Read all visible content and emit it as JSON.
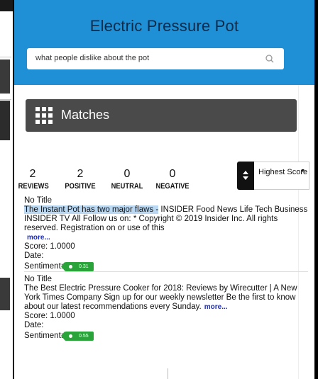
{
  "header": {
    "title": "Electric Pressure Pot",
    "search_value": "what people dislike about the pot",
    "accent": "#1f8fd6"
  },
  "matches": {
    "title": "Matches",
    "icon": "grid-icon"
  },
  "stats": [
    {
      "value": "2",
      "label": "REVIEWS"
    },
    {
      "value": "2",
      "label": "POSITIVE"
    },
    {
      "value": "0",
      "label": "NEUTRAL"
    },
    {
      "value": "0",
      "label": "NEGATIVE"
    }
  ],
  "sort": {
    "icon": "sort-icon",
    "selected": "Highest Score"
  },
  "results": [
    {
      "title": "No Title",
      "highlight": "The Instant Pot has two major flaws -",
      "snippet": " INSIDER Food News Life Tech Business INSIDER TV All Follow us on: * Copyright © 2019 Insider Inc. All rights reserved. Registration on or use of this",
      "more": "more...",
      "score": "Score: 1.0000",
      "date": "Date:",
      "sentiment_label": "Sentiment:",
      "sentiment_value": "0.31"
    },
    {
      "title": "No Title",
      "highlight": "",
      "snippet": "The Best Electric Pressure Cooker for 2018: Reviews by Wirecutter | A New York Times Company Sign up for our weekly newsletter Be the first to know about our latest recommendations every Sunday.",
      "more": "more...",
      "score": "Score: 1.0000",
      "date": "Date:",
      "sentiment_label": "Sentiment:",
      "sentiment_value": "0.55"
    }
  ],
  "colors": {
    "sentiment_positive": "#2ba33b",
    "matches_bar": "#4a4a4a",
    "link": "#1a2bcf"
  }
}
